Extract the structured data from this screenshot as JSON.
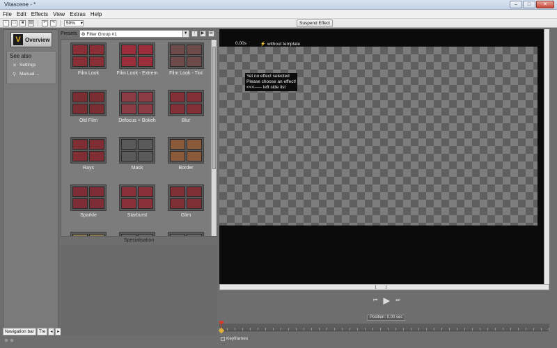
{
  "window": {
    "title": "Vitascene - *",
    "buttons": {
      "minimize": "–",
      "maximize": "□",
      "close": "✕"
    }
  },
  "menu": [
    "File",
    "Edit",
    "Effects",
    "View",
    "Extras",
    "Help"
  ],
  "toolbar": {
    "zoom": "50%",
    "suspend_label": "Suspend Effect",
    "icons": [
      "new-icon",
      "open-icon",
      "save-icon",
      "export-icon",
      "undo-icon",
      "redo-icon"
    ]
  },
  "nav": {
    "overview_label": "Overview",
    "logo_letter": "V",
    "see_also": "See also",
    "items": [
      {
        "label": "Settings",
        "icon": "✕"
      },
      {
        "label": "Manual ...",
        "icon": "⚲"
      }
    ],
    "tabs": [
      "Navigation bar",
      "Tre"
    ]
  },
  "presets": {
    "label": "Presets",
    "filter_group": "Filter Group #1",
    "items": [
      {
        "label": "Film Look",
        "color": "#8a2f35"
      },
      {
        "label": "Film Look - Extrem",
        "color": "#9c2d3a"
      },
      {
        "label": "Film Look - Tint",
        "color": "#6d4b4b"
      },
      {
        "label": "Old Film",
        "color": "#7a2e31"
      },
      {
        "label": "Defocus + Bokeh",
        "color": "#8c3c44"
      },
      {
        "label": "Blur",
        "color": "#843038"
      },
      {
        "label": "Rays",
        "color": "#802d33"
      },
      {
        "label": "Mask",
        "color": "#5a5a5a"
      },
      {
        "label": "Border",
        "color": "#8a5a3a"
      },
      {
        "label": "Sparkle",
        "color": "#7e2c35"
      },
      {
        "label": "Starburst",
        "color": "#8a3039"
      },
      {
        "label": "Glim",
        "color": "#7f3036"
      },
      {
        "label": "",
        "color": "#8a7a55"
      },
      {
        "label": "",
        "color": "#6a6a6a"
      },
      {
        "label": "",
        "color": "#6a6a6a"
      }
    ],
    "specialisation": "Specialisation"
  },
  "viewer": {
    "time": "0.00s",
    "template": "without template",
    "message": [
      "Yet no effect selected",
      "Please choose an effect!",
      "<<<----- left side list"
    ]
  },
  "transport": {
    "prev": "⏮",
    "play": "▶",
    "next": "⏭"
  },
  "timeline": {
    "position": "Position: 0.00 sec",
    "keyframes": "Keyframes"
  }
}
